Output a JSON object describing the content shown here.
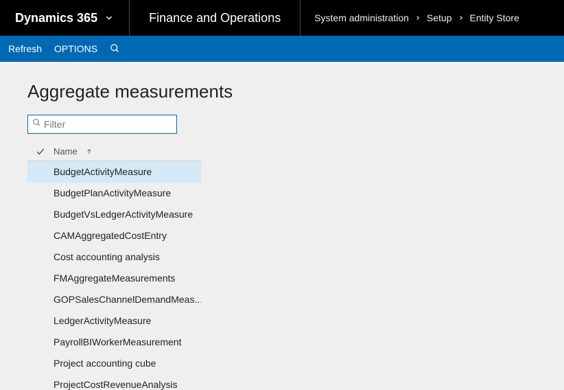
{
  "topbar": {
    "brand": "Dynamics 365",
    "module": "Finance and Operations",
    "breadcrumb": [
      "System administration",
      "Setup",
      "Entity Store"
    ]
  },
  "actionbar": {
    "refresh": "Refresh",
    "options": "OPTIONS"
  },
  "page": {
    "title": "Aggregate measurements"
  },
  "filter": {
    "placeholder": "Filter",
    "value": ""
  },
  "grid": {
    "column": "Name",
    "sort": "asc",
    "selectedIndex": 0,
    "rows": [
      "BudgetActivityMeasure",
      "BudgetPlanActivityMeasure",
      "BudgetVsLedgerActivityMeasure",
      "CAMAggregatedCostEntry",
      "Cost accounting analysis",
      "FMAggregateMeasurements",
      "GOPSalesChannelDemandMeas...",
      "LedgerActivityMeasure",
      "PayrollBIWorkerMeasurement",
      "Project accounting cube",
      "ProjectCostRevenueAnalysis"
    ]
  }
}
